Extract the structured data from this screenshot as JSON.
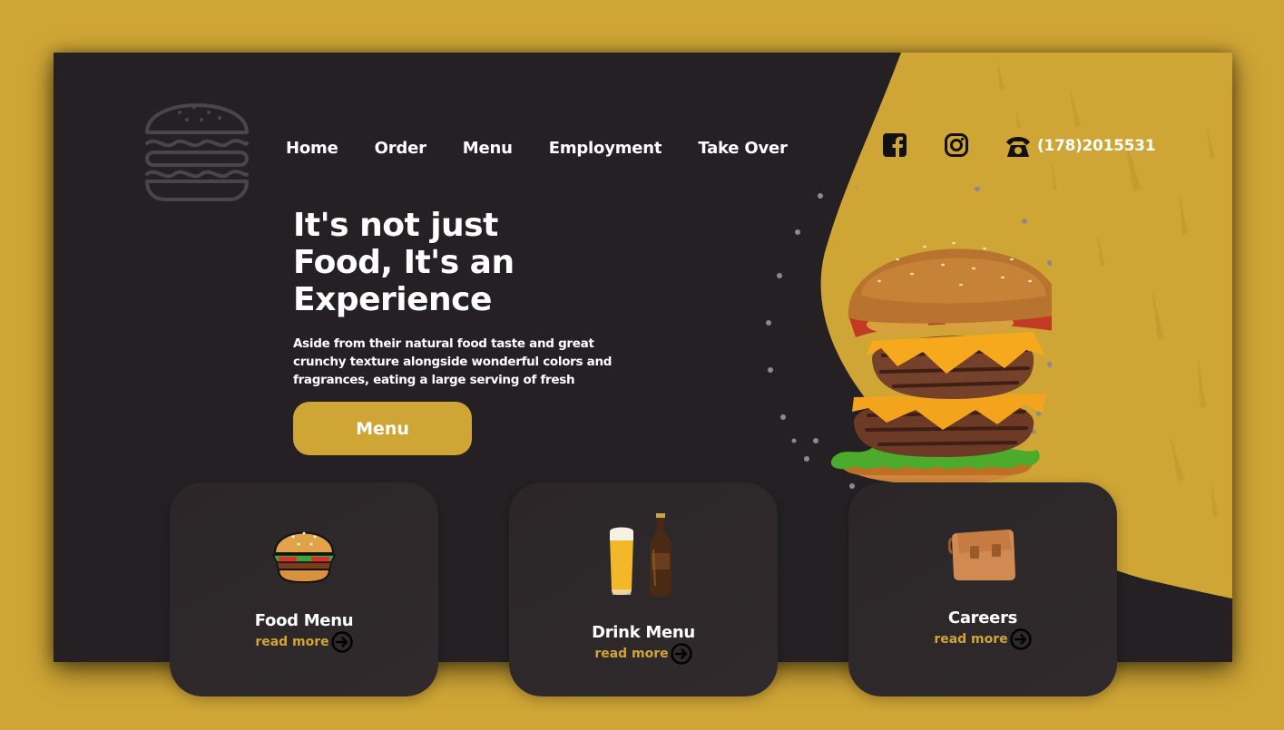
{
  "nav": {
    "items": [
      "Home",
      "Order",
      "Menu",
      "Employment",
      "Take Over"
    ]
  },
  "contact": {
    "phone": "(178)2015531"
  },
  "hero": {
    "headline_lines": [
      "It's not just",
      "Food, It's an",
      "Experience"
    ],
    "subtext": "Aside from their natural food taste and great crunchy texture alongside wonderful colors and fragrances, eating a large serving of fresh",
    "cta_label": "Menu"
  },
  "cards": [
    {
      "title": "Food Menu",
      "link": "read more",
      "icon": "hamburger-icon"
    },
    {
      "title": "Drink Menu",
      "link": "read more",
      "icon": "beer-bottle-icon"
    },
    {
      "title": "Careers",
      "link": "read more",
      "icon": "briefcase-icon"
    }
  ],
  "colors": {
    "accent": "#cfa535",
    "panel": "#242023",
    "card": "#2d282a",
    "text": "#ffffff"
  }
}
